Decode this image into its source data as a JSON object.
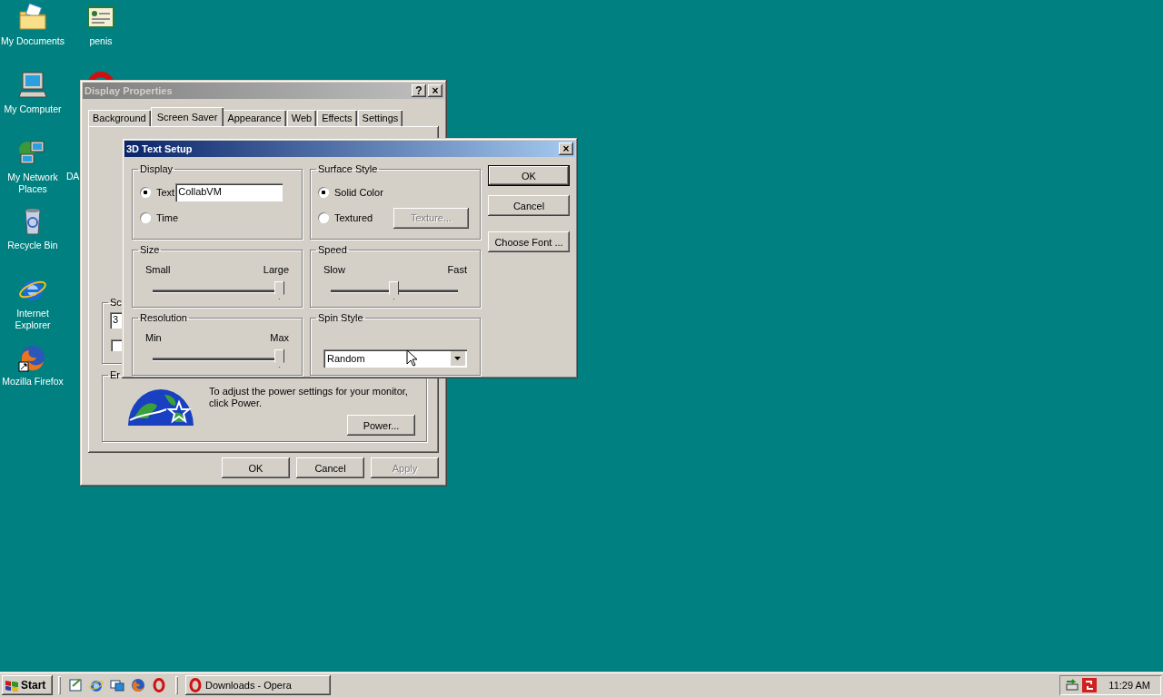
{
  "desktop_icons": [
    {
      "kind": "folder",
      "label": "My Documents"
    },
    {
      "kind": "certificate",
      "label": "penis"
    },
    {
      "kind": "computer",
      "label": "My Computer"
    },
    {
      "kind": "ring"
    },
    {
      "kind": "network",
      "label": "My Network Places"
    },
    {
      "label": "DA"
    },
    {
      "kind": "recycle",
      "label": "Recycle Bin"
    },
    {
      "kind": "ie",
      "label": "Internet Explorer"
    },
    {
      "kind": "firefox",
      "label": "Mozilla Firefox"
    }
  ],
  "display_properties": {
    "title": "Display Properties",
    "title_buttons": [
      "?",
      "×"
    ],
    "tabs": [
      {
        "label": "Background",
        "selected": false
      },
      {
        "label": "Screen Saver",
        "selected": true
      },
      {
        "label": "Appearance",
        "selected": false
      },
      {
        "label": "Web",
        "selected": false
      },
      {
        "label": "Effects",
        "selected": false
      },
      {
        "label": "Settings",
        "selected": false
      }
    ],
    "screen_saver_group": {
      "label": "Sc",
      "field_value": "3",
      "checkbox_checked": false
    },
    "energy_group": {
      "label": "Er",
      "text": "To adjust the power settings for your monitor, click Power.",
      "button": "Power..."
    },
    "buttons": [
      {
        "label": "OK",
        "disabled": false
      },
      {
        "label": "Cancel",
        "disabled": false
      },
      {
        "label": "Apply",
        "disabled": true
      }
    ]
  },
  "text_setup": {
    "title": "3D Text Setup",
    "close": "×",
    "display": {
      "label": "Display",
      "options": [
        {
          "label": "Text",
          "selected": true
        },
        {
          "label": "Time",
          "selected": false
        }
      ],
      "text_value": "CollabVM"
    },
    "surface_style": {
      "label": "Surface Style",
      "options": [
        {
          "label": "Solid Color",
          "selected": true
        },
        {
          "label": "Textured",
          "selected": false
        }
      ],
      "texture_button": {
        "label": "Texture...",
        "disabled": true
      }
    },
    "size": {
      "label": "Size",
      "min_label": "Small",
      "max_label": "Large",
      "level": 1
    },
    "speed": {
      "label": "Speed",
      "min_label": "Slow",
      "max_label": "Fast",
      "level": 0.5
    },
    "resolution": {
      "label": "Resolution",
      "min_label": "Min",
      "max_label": "Max",
      "level": 1
    },
    "spin_style": {
      "label": "Spin Style",
      "value": "Random"
    },
    "buttons": [
      {
        "label": "OK",
        "default": true
      },
      {
        "label": "Cancel",
        "default": false
      },
      {
        "label": "Choose Font ...",
        "default": false
      }
    ]
  },
  "taskbar": {
    "start": "Start",
    "task": {
      "label": "Downloads - Opera",
      "selected": false
    },
    "clock": "11:29 AM"
  }
}
